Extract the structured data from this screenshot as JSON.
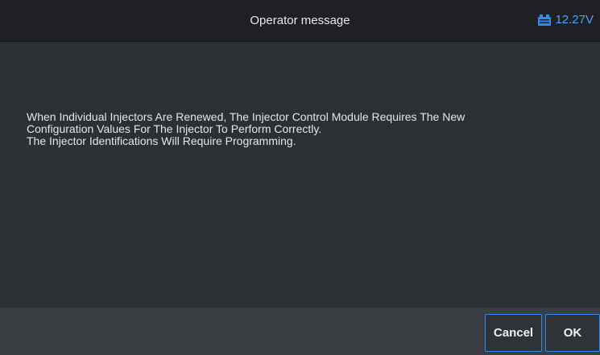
{
  "header": {
    "title": "Operator message",
    "voltage": "12.27V",
    "battery_icon": "car-battery-icon",
    "accent_color": "#2f8ae8"
  },
  "message": {
    "text": "When Individual Injectors Are Renewed, The Injector Control Module Requires The New\nConfiguration Values For The Injector To Perform Correctly.\n The Injector Identifications Will Require Programming."
  },
  "footer": {
    "cancel_label": "Cancel",
    "ok_label": "OK"
  }
}
